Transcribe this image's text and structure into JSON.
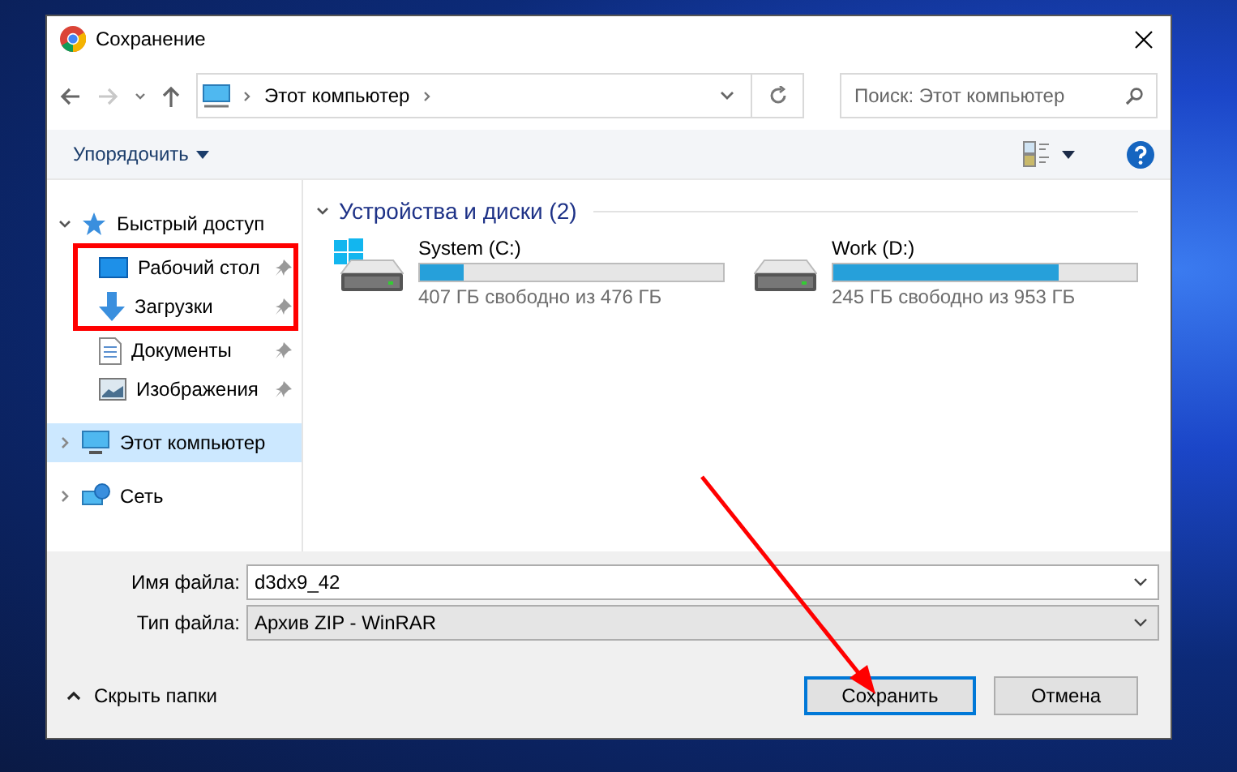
{
  "window": {
    "title": "Сохранение"
  },
  "address": {
    "parts": [
      "Этот компьютер"
    ]
  },
  "search": {
    "placeholder": "Поиск: Этот компьютер"
  },
  "toolbar": {
    "organize": "Упорядочить"
  },
  "sidebar": {
    "items": [
      {
        "label": "Быстрый доступ",
        "kind": "star",
        "expanded": true,
        "selected": false,
        "children": [
          {
            "label": "Рабочий стол",
            "kind": "desktop",
            "pinned": true,
            "annotated": true
          },
          {
            "label": "Загрузки",
            "kind": "downloads",
            "pinned": true,
            "annotated": true
          },
          {
            "label": "Документы",
            "kind": "documents",
            "pinned": true,
            "annotated": false
          },
          {
            "label": "Изображения",
            "kind": "pictures",
            "pinned": true,
            "annotated": false
          }
        ]
      },
      {
        "label": "Этот компьютер",
        "kind": "computer",
        "expanded": false,
        "selected": true
      },
      {
        "label": "Сеть",
        "kind": "network",
        "expanded": false,
        "selected": false
      }
    ]
  },
  "section": {
    "title": "Устройства и диски (2)",
    "expanded": true
  },
  "drives": [
    {
      "name": "System (C:)",
      "kind": "windows",
      "level": 0.145,
      "info": "407 ГБ свободно из 476 ГБ"
    },
    {
      "name": "Work (D:)",
      "kind": "plain",
      "level": 0.743,
      "info": "245 ГБ свободно из 953 ГБ"
    }
  ],
  "filename": {
    "label": "Имя файла:",
    "value": "d3dx9_42"
  },
  "filetype": {
    "label": "Тип файла:",
    "value": "Архив ZIP - WinRAR"
  },
  "hide_folders": "Скрыть папки",
  "buttons": [
    {
      "label": "Сохранить",
      "default": true
    },
    {
      "label": "Отмена",
      "default": false
    }
  ]
}
